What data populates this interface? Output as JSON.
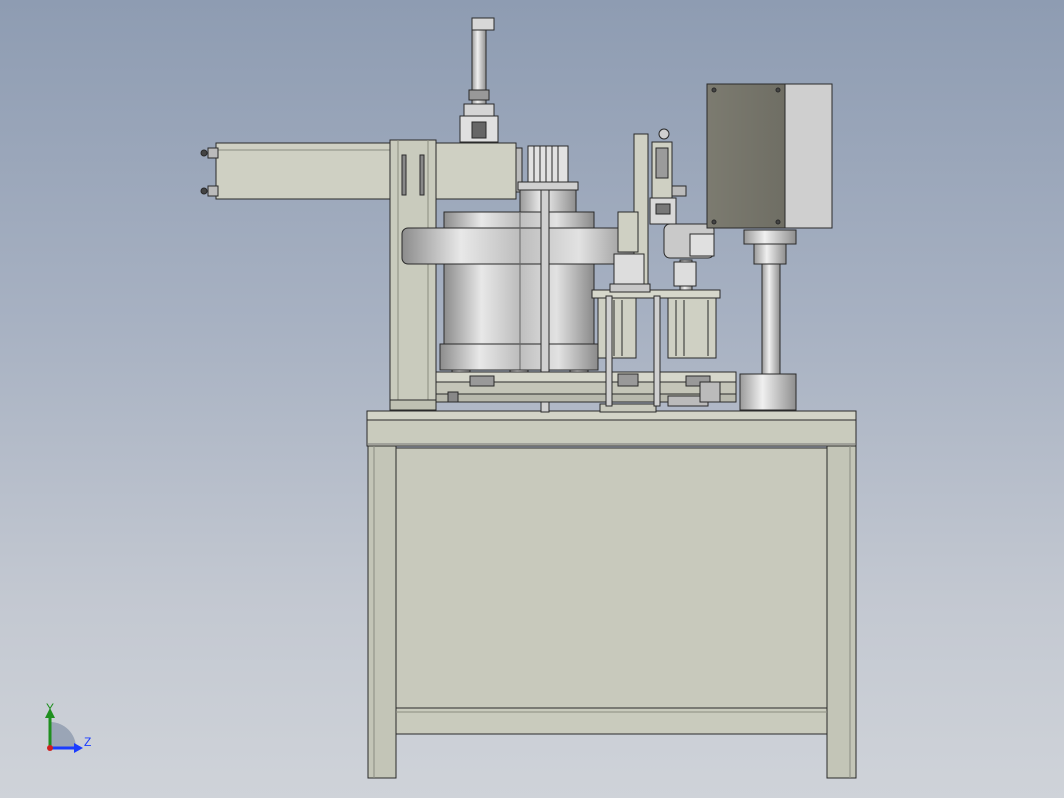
{
  "view": {
    "background_top": "#8e9cb2",
    "background_bottom": "#cfd3d9"
  },
  "model": {
    "part_color": "#c9cbbd",
    "part_shade": "#a9ab9d",
    "metal_light": "#e6e6e6",
    "metal_dark": "#8a8a8a",
    "edge_color": "#2a2a2a",
    "cabinet_color": "#7e7d72"
  },
  "triad": {
    "y_label": "Y",
    "z_label": "Z",
    "y_color": "#1f8f1f",
    "z_color": "#1a3cff"
  }
}
